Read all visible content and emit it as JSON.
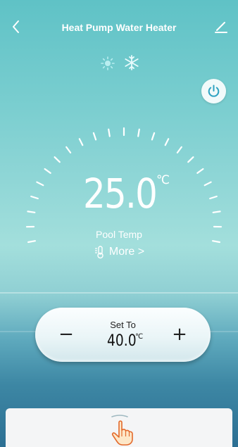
{
  "header": {
    "title": "Heat Pump Water Heater",
    "back_icon": "chevron-left-icon",
    "edit_icon": "pencil-icon"
  },
  "modes": {
    "heat_icon": "sun-icon",
    "cool_icon": "snowflake-icon"
  },
  "power": {
    "icon": "power-icon"
  },
  "display": {
    "temperature": "25.0",
    "unit": "℃",
    "label": "Pool Temp",
    "more_label": "More >"
  },
  "setpoint": {
    "label": "Set To",
    "value": "40.0",
    "unit": "℃",
    "minus_label": "−",
    "plus_label": "+"
  },
  "colors": {
    "sky": "#5fc2c6",
    "sea": "#2c6f93",
    "panel": "#f4f5f6",
    "accent": "#2fa3c2"
  }
}
